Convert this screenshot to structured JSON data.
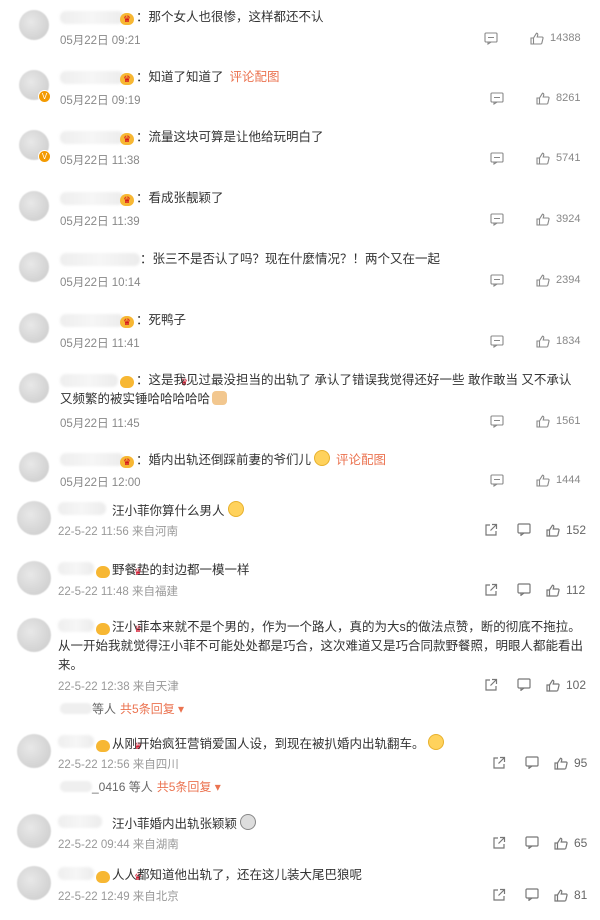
{
  "comments": [
    {
      "name": "0嗯嗯嗯09",
      "text": "那个女人也很惨，这样都还不认",
      "time": "05月22日 09:21",
      "likes": "14388"
    },
    {
      "name": "了",
      "text": "知道了知道了",
      "pic": "评论配图",
      "time": "05月22日 09:19",
      "likes": "8261"
    },
    {
      "text": "流量这块可算是让他给玩明白了",
      "time": "05月22日 11:38",
      "likes": "5741"
    },
    {
      "text": "看成张靓颖了",
      "time": "05月22日 11:39",
      "likes": "3924"
    },
    {
      "text": "张三不是否认了吗？现在什麼情况？！两个又在一起",
      "time": "05月22日 10:14",
      "likes": "2394"
    },
    {
      "text": "死鸭子",
      "time": "05月22日 11:41",
      "likes": "1834"
    },
    {
      "text": "这是我见过最没担当的出轨了 承认了错误我觉得还好一些  敢作敢当 又不承认又频繁的被实锤哈哈哈哈哈",
      "time": "05月22日 11:45",
      "likes": "1561"
    },
    {
      "text": "婚内出轨还倒踩前妻的爷们儿",
      "pic": "评论配图",
      "time": "05月22日 12:00",
      "likes": "1444"
    }
  ],
  "comments2": [
    {
      "name": "儿x",
      "text": "汪小菲你算什么男人",
      "meta": "22-5-22 11:56 来自河南",
      "likes": "152"
    },
    {
      "text": "野餐垫的封边都一模一样",
      "meta": "22-5-22 11:48 来自福建",
      "likes": "112"
    },
    {
      "text": "汪小菲本来就不是个男的，作为一个路人，真的为大s的做法点赞，断的彻底不拖拉。从一开始我就觉得汪小菲不可能处处都是巧合，这次难道又是巧合同款野餐照，明眼人都能看出来。",
      "meta": "22-5-22 12:38 来自天津",
      "likes": "102",
      "reply_prefix": "等人",
      "reply_more": "共5条回复"
    },
    {
      "text": "从刚开始疯狂营销爱国人设，到现在被扒婚内出轨翻车。",
      "meta": "22-5-22 12:56 来自四川",
      "likes": "95",
      "reply_prefix": "_0416 等人",
      "reply_more": "共5条回复"
    },
    {
      "name": "汪",
      "text": "汪小菲婚内出轨张颖颖",
      "meta": "22-5-22 09:44 来自湖南",
      "likes": "65"
    },
    {
      "text": "人人都知道他出轨了，还在这儿装大尾巴狼呢",
      "meta": "22-5-22 12:49 来自北京",
      "likes": "81"
    }
  ]
}
